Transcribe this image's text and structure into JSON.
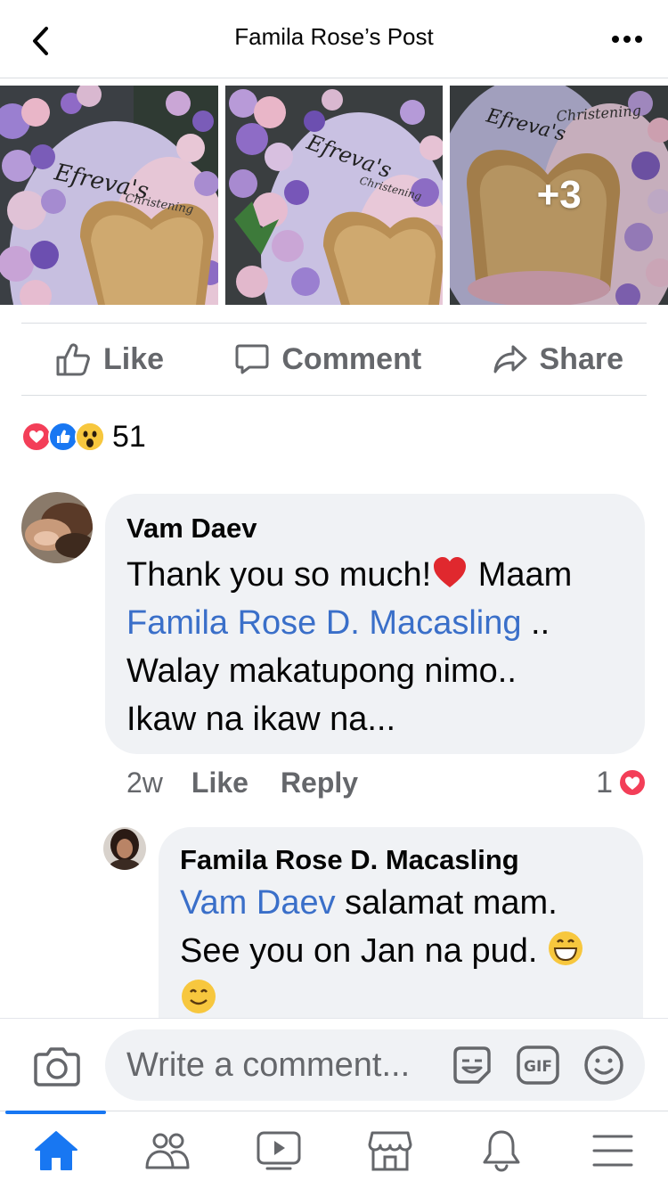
{
  "header": {
    "title": "Famila Rose’s Post"
  },
  "photos": {
    "more_count": "+3"
  },
  "actions": {
    "like_label": "Like",
    "comment_label": "Comment",
    "share_label": "Share"
  },
  "reactions": {
    "count": "51"
  },
  "comments": [
    {
      "author": "Vam Daev",
      "text_1": "Thank you so much!",
      "text_2": " Maam",
      "mention": "Famila Rose D. Macasling",
      "text_3": " ..",
      "text_4": "Walay makatupong nimo..",
      "text_5": "Ikaw na ikaw na...",
      "time": "2w",
      "like_label": "Like",
      "reply_label": "Reply",
      "reaction_count": "1"
    },
    {
      "author": "Famila Rose D. Macasling",
      "mention": "Vam Daev",
      "text_1": " salamat mam.",
      "text_2": "See you on Jan na pud. "
    }
  ],
  "composer": {
    "placeholder": "Write a comment..."
  },
  "colors": {
    "brand_blue": "#1877f2",
    "mention_blue": "#3a6fc9",
    "love_red": "#f33e58",
    "bubble_bg": "#f0f2f5"
  },
  "nav": [
    "home-icon",
    "friends-icon",
    "watch-icon",
    "marketplace-icon",
    "notifications-icon",
    "menu-icon"
  ]
}
